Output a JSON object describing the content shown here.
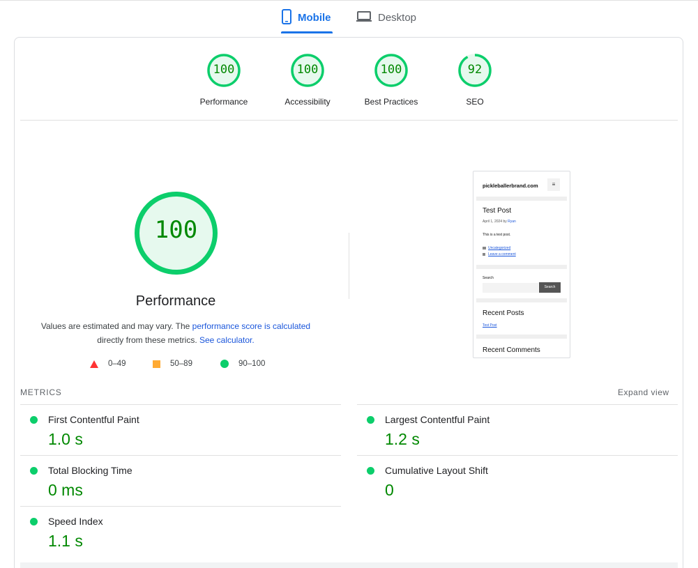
{
  "tabs": {
    "mobile": "Mobile",
    "desktop": "Desktop"
  },
  "colors": {
    "accent": "#1a73e8",
    "pass": "#0cce6b",
    "pass_text": "#008800",
    "average": "#ffaa33",
    "fail": "#ff3333"
  },
  "summary": [
    {
      "score": "100",
      "label": "Performance",
      "value": 100
    },
    {
      "score": "100",
      "label": "Accessibility",
      "value": 100
    },
    {
      "score": "100",
      "label": "Best Practices",
      "value": 100
    },
    {
      "score": "92",
      "label": "SEO",
      "value": 92
    }
  ],
  "performance": {
    "score": "100",
    "value": 100,
    "title": "Performance",
    "desc_before": "Values are estimated and may vary. The ",
    "desc_link1": "performance score is calculated",
    "desc_middle": " directly from these metrics. ",
    "desc_link2": "See calculator.",
    "legend": {
      "fail": "0–49",
      "average": "50–89",
      "pass": "90–100"
    }
  },
  "screenshot": {
    "site": "pickleballerbrand.com",
    "menu": "≡",
    "post_title": "Test Post",
    "post_meta": "April 1, 2024 by",
    "post_author": "Ryan",
    "post_body": "This is a test post.",
    "category": "Uncategorized",
    "comment_link": "Leave a comment",
    "search_label": "Search",
    "search_button": "Search",
    "recent_posts": "Recent Posts",
    "recent_post_item": "Test Post",
    "recent_comments": "Recent Comments"
  },
  "metrics": {
    "heading": "METRICS",
    "expand": "Expand view",
    "items": [
      {
        "name": "First Contentful Paint",
        "value": "1.0 s"
      },
      {
        "name": "Largest Contentful Paint",
        "value": "1.2 s"
      },
      {
        "name": "Total Blocking Time",
        "value": "0 ms"
      },
      {
        "name": "Cumulative Layout Shift",
        "value": "0"
      },
      {
        "name": "Speed Index",
        "value": "1.1 s"
      }
    ]
  }
}
